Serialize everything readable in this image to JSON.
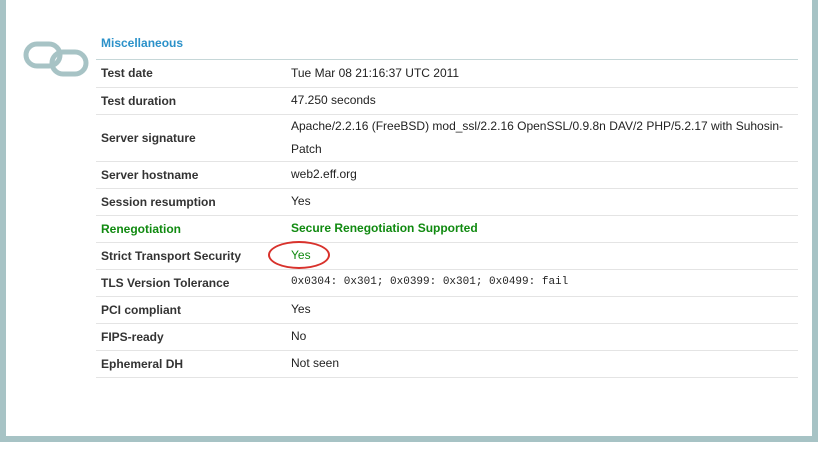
{
  "section": {
    "title": "Miscellaneous",
    "icon": "chain-link-icon"
  },
  "rows": [
    {
      "label": "Test date",
      "value": "Tue Mar 08 21:16:37 UTC 2011"
    },
    {
      "label": "Test duration",
      "value": "47.250 seconds"
    },
    {
      "label": "Server signature",
      "value": "Apache/2.2.16 (FreeBSD) mod_ssl/2.2.16 OpenSSL/0.9.8n DAV/2 PHP/5.2.17 with Suhosin-Patch"
    },
    {
      "label": "Server hostname",
      "value": "web2.eff.org"
    },
    {
      "label": "Session resumption",
      "value": "Yes"
    },
    {
      "label": "Renegotiation",
      "value": "Secure Renegotiation Supported"
    },
    {
      "label": "Strict Transport Security",
      "value": "Yes"
    },
    {
      "label": "TLS Version Tolerance",
      "value": "0x0304: 0x301; 0x0399: 0x301; 0x0499: fail"
    },
    {
      "label": "PCI compliant",
      "value": "Yes"
    },
    {
      "label": "FIPS-ready",
      "value": "No"
    },
    {
      "label": "Ephemeral DH",
      "value": "Not seen"
    }
  ],
  "colors": {
    "accent": "#2b91c9",
    "positive": "#108a10",
    "highlight": "#d8322c",
    "frame": "#a7c3c5"
  }
}
